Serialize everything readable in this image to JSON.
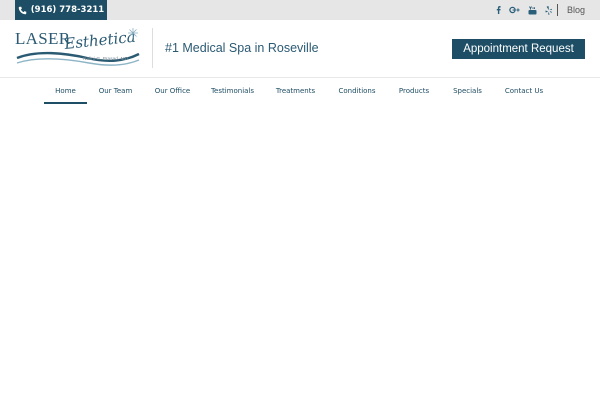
{
  "topbar": {
    "phone": "(916) 778-3211",
    "social_icons": [
      "facebook-icon",
      "google-plus-icon",
      "youtube-icon",
      "yelp-icon"
    ],
    "blog_label": "Blog"
  },
  "header": {
    "logo": {
      "word1": "LASER",
      "word2": "Esthetica",
      "doctor": "Nalini G. Prasad, MD"
    },
    "tagline": "#1 Medical Spa in Roseville",
    "cta_label": "Appointment Request"
  },
  "nav": {
    "items": [
      {
        "label": "Home",
        "active": true
      },
      {
        "label": "Our Team"
      },
      {
        "label": "Our Office"
      },
      {
        "label": "Testimonials"
      },
      {
        "label": "Treatments"
      },
      {
        "label": "Conditions"
      },
      {
        "label": "Products"
      },
      {
        "label": "Specials"
      },
      {
        "label": "Contact Us"
      }
    ]
  },
  "colors": {
    "brand": "#1d4e66",
    "topbar_bg": "#e6e6e6",
    "nav_text": "#1e4d63"
  }
}
